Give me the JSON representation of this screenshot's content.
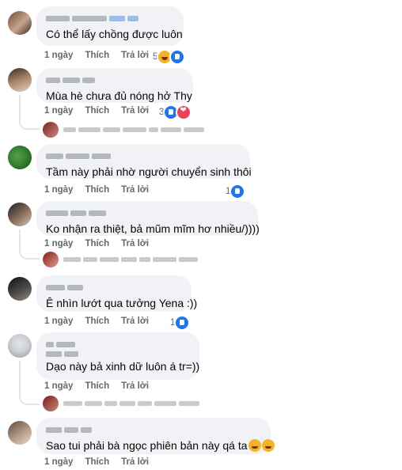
{
  "comments": [
    {
      "text": "Có thể lấy chồng được luôn",
      "time": "1 ngày",
      "like": "Thích",
      "reply": "Trả lời",
      "reactions": {
        "count": "5",
        "icons": [
          "haha-icon",
          "like-icon"
        ]
      },
      "avatar_colors": [
        "#6b4a3a",
        "#c9a48a",
        "#2a2a2a"
      ],
      "has_reply": false
    },
    {
      "text": "Mùa hè chưa đủ nóng hở Thy",
      "time": "1 ngày",
      "like": "Thích",
      "reply": "Trả lời",
      "reactions": {
        "count": "3",
        "icons": [
          "like-icon",
          "love-icon"
        ]
      },
      "avatar_colors": [
        "#3b2a20",
        "#a9856b",
        "#e3d2c0"
      ],
      "has_reply": true
    },
    {
      "text": "Tầm này phải nhờ người chuyển sinh thôi",
      "time": "1 ngày",
      "like": "Thích",
      "reply": "Trả lời",
      "reactions": {
        "count": "1",
        "icons": [
          "like-icon"
        ]
      },
      "avatar_colors": [
        "#2f7a2c",
        "#5aa04a",
        "#1c4a1a"
      ],
      "has_reply": false
    },
    {
      "text": "Ko nhận ra thiệt, bả mũm mĩm hơ nhiều/))))",
      "time": "1 ngày",
      "like": "Thích",
      "reply": "Trả lời",
      "reactions": {
        "count": "",
        "icons": []
      },
      "avatar_colors": [
        "#1f1f1f",
        "#8a6f5c",
        "#d9c6b5"
      ],
      "has_reply": true
    },
    {
      "text": "Ê nhìn lướt qua tưởng Yena :))",
      "time": "1 ngày",
      "like": "Thích",
      "reply": "Trả lời",
      "reactions": {
        "count": "1",
        "icons": [
          "like-icon"
        ]
      },
      "avatar_colors": [
        "#111111",
        "#4a4a4a",
        "#9a8a7a"
      ],
      "has_reply": false
    },
    {
      "text": "Dạo này bả xinh dữ luôn á tr=))",
      "time": "1 ngày",
      "like": "Thích",
      "reply": "Trả lời",
      "reactions": {
        "count": "",
        "icons": []
      },
      "avatar_colors": [
        "#c9ccd1",
        "#8d949e",
        "#e4e6eb"
      ],
      "has_reply": true
    },
    {
      "text": "Sao tui phải bà ngọc phiên bản này qá ta",
      "time": "1 ngày",
      "like": "Thích",
      "reply": "Trả lời",
      "reactions": {
        "count": "",
        "icons": []
      },
      "avatar_colors": [
        "#5c4a3d",
        "#b69b86",
        "#e8dccf"
      ],
      "has_reply": false
    }
  ]
}
